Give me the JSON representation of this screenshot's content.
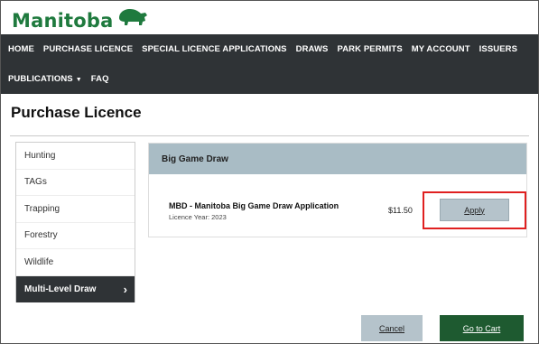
{
  "brand": {
    "logo_text": "Manitoba",
    "logo_icon": "bison-icon"
  },
  "nav": {
    "row1": [
      "HOME",
      "PURCHASE LICENCE",
      "SPECIAL LICENCE APPLICATIONS",
      "DRAWS",
      "PARK PERMITS",
      "MY ACCOUNT",
      "ISSUERS"
    ],
    "row2": [
      "PUBLICATIONS",
      "FAQ"
    ],
    "publications_caret": "▼"
  },
  "page": {
    "title": "Purchase Licence"
  },
  "sidebar": {
    "items": [
      {
        "label": "Hunting"
      },
      {
        "label": "TAGs"
      },
      {
        "label": "Trapping"
      },
      {
        "label": "Forestry"
      },
      {
        "label": "Wildlife"
      },
      {
        "label": "Multi-Level Draw",
        "active": true
      }
    ],
    "active_chevron": "›"
  },
  "panel": {
    "heading": "Big Game Draw",
    "item": {
      "title": "MBD - Manitoba Big Game Draw Application",
      "subtitle": "Licence Year: 2023",
      "price": "$11.50",
      "apply_label": "Apply"
    }
  },
  "footer": {
    "cancel_label": "Cancel",
    "cart_label": "Go to Cart"
  },
  "colors": {
    "brand_green": "#1f7a3e",
    "nav_bg": "#2f3336",
    "panel_head": "#a9bcc5",
    "button_gray": "#b5c3cb",
    "cart_green": "#1e5a30",
    "highlight": "#e02020"
  }
}
